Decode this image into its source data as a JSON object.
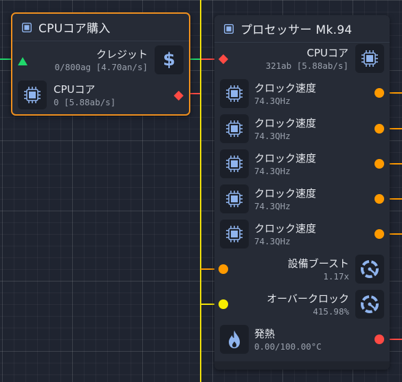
{
  "colors": {
    "accent_orange": "#f0901e",
    "wire_yellow": "#f2e20a",
    "port_orange": "#ff9a00",
    "port_yellow": "#f7ee00",
    "port_red": "#ff4a44",
    "port_green": "#20d86b",
    "icon_blue": "#8fb4ee"
  },
  "purchase_node": {
    "title": "CPUコア購入",
    "credit": {
      "label": "クレジット",
      "value": "0/800ag [4.70an/s]",
      "icon": "dollar-icon",
      "port": "green-triangle"
    },
    "cpu_core": {
      "label": "CPUコア",
      "value": "0 [5.88ab/s]",
      "icon": "chip-icon",
      "port": "red-diamond"
    }
  },
  "processor_node": {
    "title": "プロセッサー Mk.94",
    "cpu_input": {
      "label": "CPUコア",
      "value": "321ab [5.88ab/s]",
      "icon": "chip-icon",
      "port": "red-diamond"
    },
    "clock_rows": [
      {
        "label": "クロック速度",
        "value": "74.3QHz",
        "icon": "chip-icon"
      },
      {
        "label": "クロック速度",
        "value": "74.3QHz",
        "icon": "chip-icon"
      },
      {
        "label": "クロック速度",
        "value": "74.3QHz",
        "icon": "chip-icon"
      },
      {
        "label": "クロック速度",
        "value": "74.3QHz",
        "icon": "chip-icon"
      },
      {
        "label": "クロック速度",
        "value": "74.3QHz",
        "icon": "chip-icon"
      }
    ],
    "boost": {
      "label": "設備ブースト",
      "value": "1.17x",
      "icon": "gauge-icon"
    },
    "overclock": {
      "label": "オーバークロック",
      "value": "415.98%",
      "icon": "gauge-icon"
    },
    "heat": {
      "label": "発熱",
      "value": "0.00/100.00°C",
      "icon": "flame-icon"
    }
  }
}
